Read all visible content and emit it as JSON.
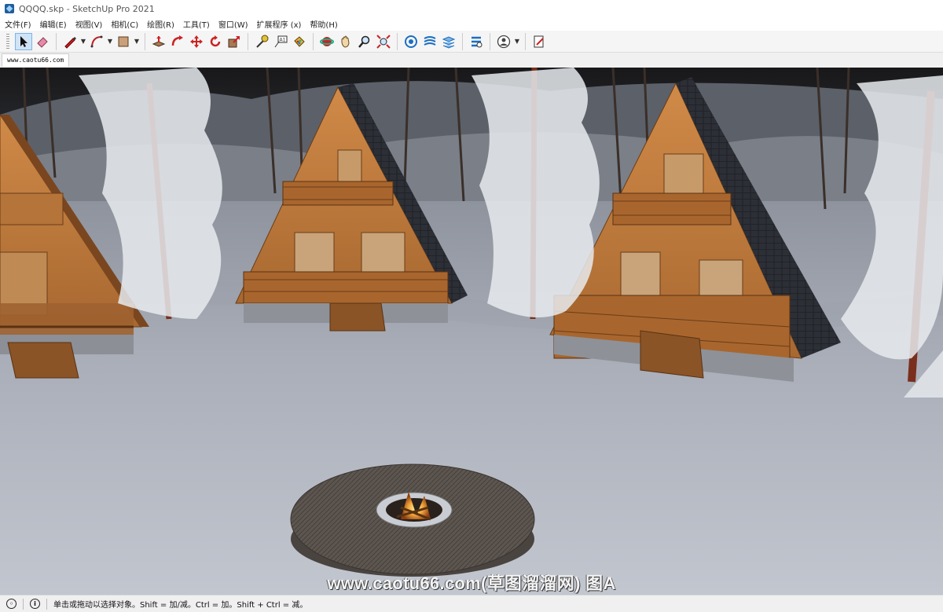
{
  "window": {
    "title": "QQQQ.skp - SketchUp Pro 2021"
  },
  "menu": [
    {
      "label": "文件(F)"
    },
    {
      "label": "编辑(E)"
    },
    {
      "label": "视图(V)"
    },
    {
      "label": "相机(C)"
    },
    {
      "label": "绘图(R)"
    },
    {
      "label": "工具(T)"
    },
    {
      "label": "窗口(W)"
    },
    {
      "label": "扩展程序 (x)"
    },
    {
      "label": "帮助(H)"
    }
  ],
  "toolbar": {
    "tools": [
      {
        "name": "select-icon",
        "active": true
      },
      {
        "name": "eraser-icon"
      },
      {
        "name": "pencil-line-icon"
      },
      {
        "name": "arc-icon"
      },
      {
        "name": "rectangle-icon"
      },
      {
        "name": "push-pull-icon"
      },
      {
        "name": "follow-me-icon"
      },
      {
        "name": "move-icon"
      },
      {
        "name": "rotate-icon"
      },
      {
        "name": "scale-icon"
      },
      {
        "name": "tape-measure-icon"
      },
      {
        "name": "text-label-icon"
      },
      {
        "name": "paint-bucket-icon"
      },
      {
        "name": "orbit-icon"
      },
      {
        "name": "pan-icon"
      },
      {
        "name": "zoom-icon"
      },
      {
        "name": "zoom-extents-icon"
      },
      {
        "name": "warehouse-icon"
      },
      {
        "name": "extension-warehouse-icon"
      },
      {
        "name": "layout-icon"
      },
      {
        "name": "extension-manager-icon"
      },
      {
        "name": "account-icon"
      },
      {
        "name": "send-to-layout-icon"
      }
    ],
    "accent_color": "#2e7bd1"
  },
  "scene_tabs": [
    {
      "label": "www.caotu66.com"
    }
  ],
  "viewport": {
    "watermark": "www.caotu66.com(草图溜溜网) 图A",
    "sky_color": "#1c1c1e",
    "ground_color": "#b9bdc7",
    "roof_color": "#2c2f36",
    "wood_color": "#c07a3e"
  },
  "status": {
    "message": "单击或拖动以选择对象。Shift = 加/减。Ctrl = 加。Shift + Ctrl = 减。"
  }
}
